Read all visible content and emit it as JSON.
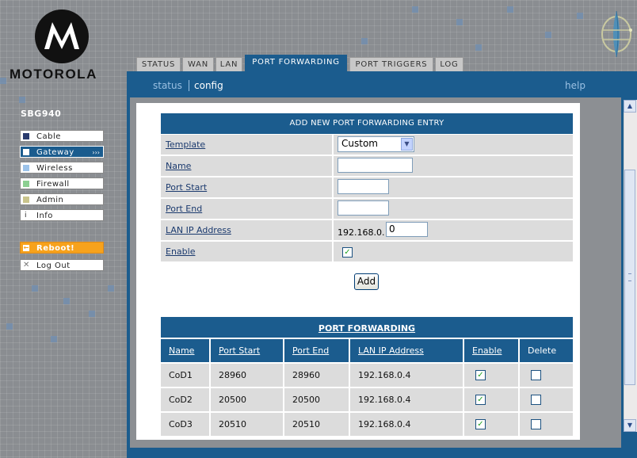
{
  "brand": "MOTOROLA",
  "model": "SBG940",
  "tabs": [
    "STATUS",
    "WAN",
    "LAN",
    "PORT FORWARDING",
    "PORT TRIGGERS",
    "LOG"
  ],
  "active_tab": "PORT FORWARDING",
  "subnav": {
    "status": "status",
    "config": "config",
    "help": "help"
  },
  "sidebar": {
    "items": [
      {
        "label": "Cable",
        "color": "#2a3b6e"
      },
      {
        "label": "Gateway",
        "color": "#ffffff",
        "active": true,
        "arrow": "›››"
      },
      {
        "label": "Wireless",
        "color": "#9cc3ea"
      },
      {
        "label": "Firewall",
        "color": "#8ccf92"
      },
      {
        "label": "Admin",
        "color": "#c9c48c"
      },
      {
        "label": "Info",
        "glyph": "i"
      }
    ],
    "reboot": {
      "label": "Reboot!",
      "icon": "arrow-left-icon"
    },
    "logout": {
      "label": "Log Out",
      "icon": "x-icon"
    }
  },
  "form": {
    "title": "ADD NEW PORT FORWARDING ENTRY",
    "template_label": "Template",
    "template_value": "Custom",
    "name_label": "Name",
    "name_value": "",
    "port_start_label": "Port Start",
    "port_start_value": "",
    "port_end_label": "Port End",
    "port_end_value": "",
    "lan_ip_label": "LAN IP Address",
    "lan_ip_prefix": "192.168.0.",
    "lan_ip_value": "0",
    "enable_label": "Enable",
    "enable_checked": true,
    "add_button": "Add"
  },
  "list": {
    "title": "PORT FORWARDING",
    "headers": [
      "Name",
      "Port Start",
      "Port End",
      "LAN IP Address",
      "Enable",
      "Delete"
    ],
    "rows": [
      {
        "name": "CoD1",
        "port_start": "28960",
        "port_end": "28960",
        "ip": "192.168.0.4",
        "enable": true,
        "delete": false
      },
      {
        "name": "CoD2",
        "port_start": "20500",
        "port_end": "20500",
        "ip": "192.168.0.4",
        "enable": true,
        "delete": false
      },
      {
        "name": "CoD3",
        "port_start": "20510",
        "port_end": "20510",
        "ip": "192.168.0.4",
        "enable": true,
        "delete": false
      }
    ]
  },
  "colors": {
    "accent": "#1b5c8e",
    "reboot": "#f7a21c",
    "link": "#1b3a6e"
  }
}
